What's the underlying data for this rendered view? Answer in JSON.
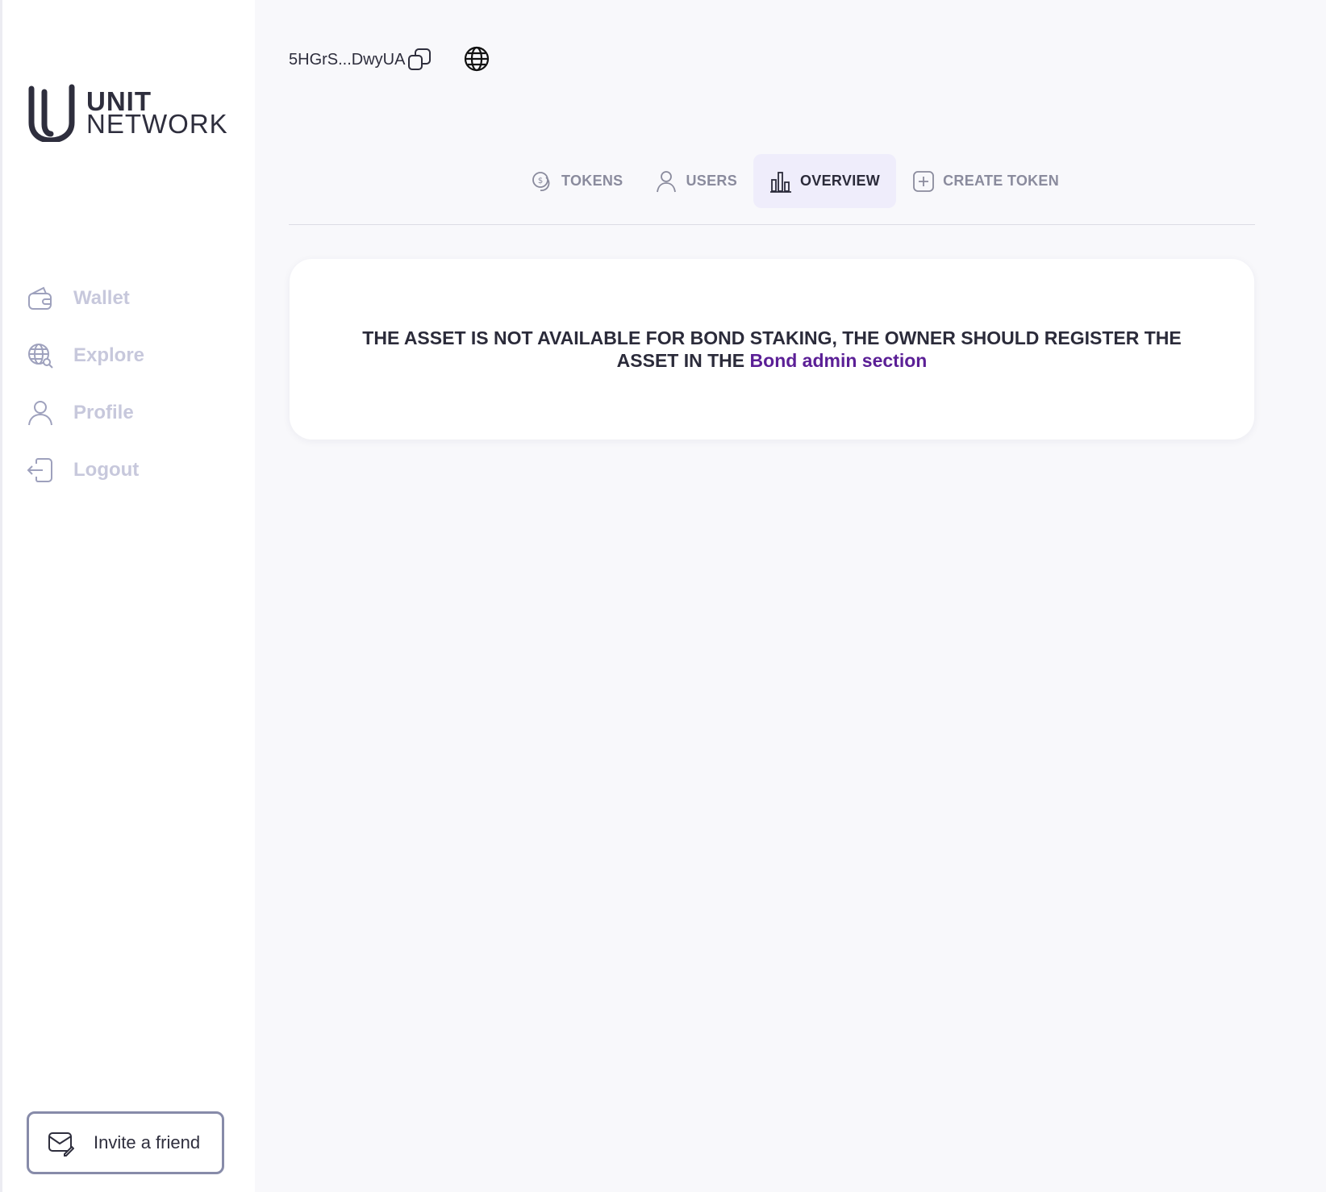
{
  "brand": {
    "name_line1": "UNIT",
    "name_line2": "NETWORK"
  },
  "sidebar": {
    "items": [
      {
        "label": "Wallet",
        "icon": "wallet-icon"
      },
      {
        "label": "Explore",
        "icon": "explore-globe-icon"
      },
      {
        "label": "Profile",
        "icon": "user-icon"
      },
      {
        "label": "Logout",
        "icon": "logout-icon"
      }
    ],
    "invite_label": "Invite a friend"
  },
  "header": {
    "address": "5HGrS...DwyUA"
  },
  "tabs": [
    {
      "label": "TOKENS",
      "icon": "coin-icon",
      "active": false
    },
    {
      "label": "USERS",
      "icon": "user-icon",
      "active": false
    },
    {
      "label": "OVERVIEW",
      "icon": "bar-chart-icon",
      "active": true
    },
    {
      "label": "CREATE TOKEN",
      "icon": "plus-square-icon",
      "active": false
    }
  ],
  "message": {
    "text": "THE ASSET IS NOT AVAILABLE FOR BOND STAKING, THE OWNER SHOULD REGISTER THE ASSET IN THE",
    "link": "Bond admin section"
  },
  "colors": {
    "accent": "#5b1f96",
    "active_tab_bg": "#efedfb",
    "nav_muted": "#c7c8dc"
  }
}
